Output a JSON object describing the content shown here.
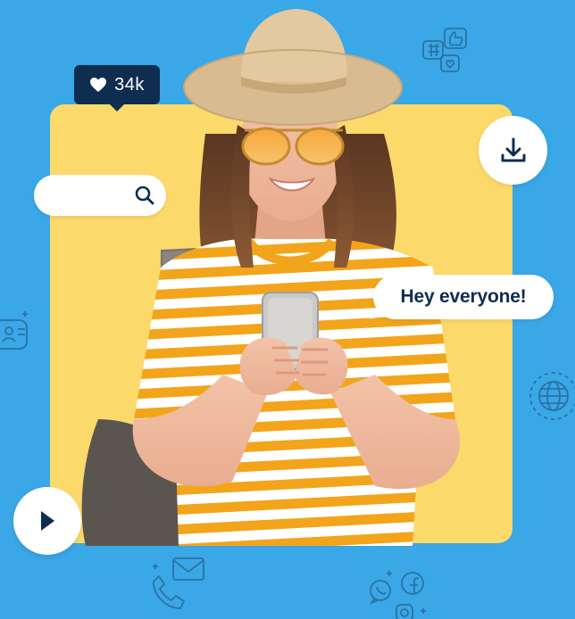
{
  "likes": {
    "count": "34k",
    "icon": "heart-icon"
  },
  "search": {
    "value": "",
    "placeholder": "",
    "icon": "search-icon"
  },
  "download": {
    "icon": "download-icon"
  },
  "speech": {
    "text": "Hey everyone!"
  },
  "player": {
    "icon": "play-icon"
  },
  "colors": {
    "background": "#3aa7e6",
    "card": "#fcd96b",
    "navy": "#0f2d4f",
    "white": "#ffffff",
    "shirt_stripe": "#f2a51a"
  },
  "background_icons": [
    "social-hashtag-like-icon",
    "contact-card-icon",
    "globe-icon",
    "phone-mail-icon",
    "social-media-icon"
  ]
}
